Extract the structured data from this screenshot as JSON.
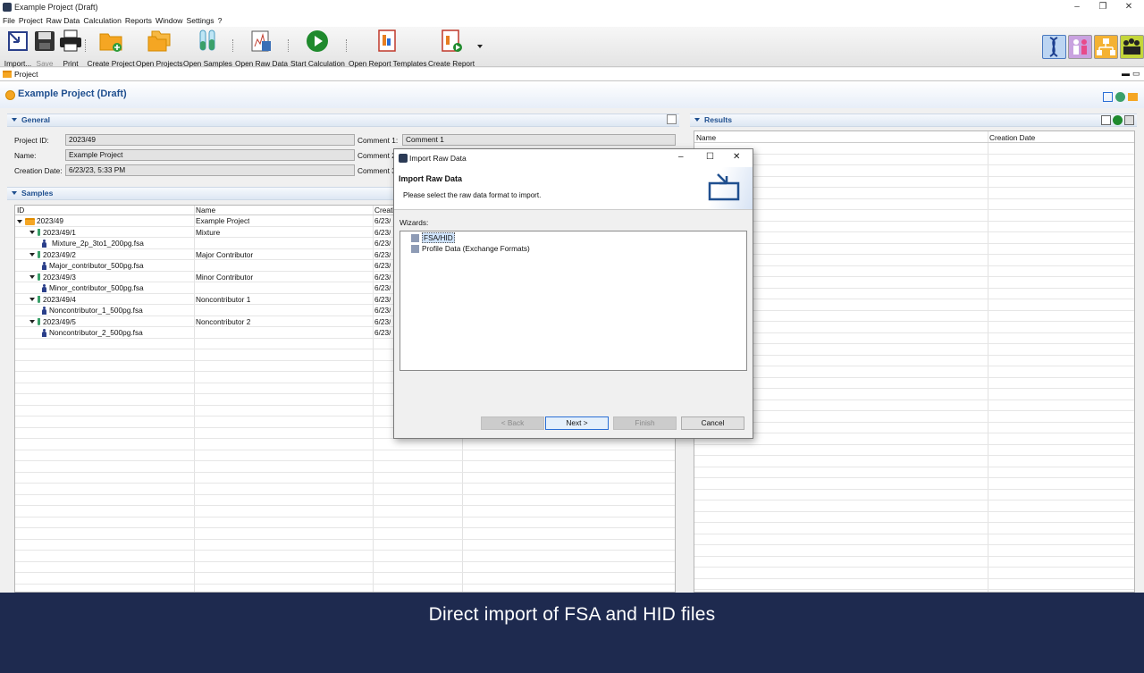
{
  "window": {
    "title": "Example Project (Draft)"
  },
  "menu": [
    "File",
    "Project",
    "Raw Data",
    "Calculation",
    "Reports",
    "Window",
    "Settings",
    "?"
  ],
  "toolbar": {
    "import": "Import...",
    "save": "Save",
    "print": "Print",
    "create_project": "Create Project",
    "open_projects": "Open Projects",
    "open_samples": "Open Samples",
    "open_raw_data": "Open Raw Data",
    "start_calculation": "Start Calculation",
    "open_report_templates": "Open Report Templates",
    "create_report": "Create Report"
  },
  "tab": {
    "project": "Project"
  },
  "project": {
    "title": "Example Project (Draft)"
  },
  "general": {
    "heading": "General",
    "project_id_label": "Project ID:",
    "project_id": "2023/49",
    "name_label": "Name:",
    "name": "Example Project",
    "creation_date_label": "Creation Date:",
    "creation_date": "6/23/23, 5:33 PM",
    "comment1_label": "Comment 1:",
    "comment1": "Comment 1",
    "comment2_label": "Comment 2",
    "comment3_label": "Comment 3"
  },
  "samples": {
    "heading": "Samples",
    "columns": [
      "ID",
      "Name",
      "Creati"
    ],
    "rows": [
      {
        "id": "2023/49",
        "name": "Example Project",
        "date": "6/23/",
        "level": 0,
        "kind": "folder"
      },
      {
        "id": "2023/49/1",
        "name": "Mixture",
        "date": "6/23/",
        "level": 1,
        "kind": "sample"
      },
      {
        "id": "Mixture_2p_3to1_200pg.fsa",
        "name": "",
        "date": "6/23/",
        "level": 2,
        "kind": "group"
      },
      {
        "id": "2023/49/2",
        "name": "Major Contributor",
        "date": "6/23/",
        "level": 1,
        "kind": "sample"
      },
      {
        "id": "Major_contributor_500pg.fsa",
        "name": "",
        "date": "6/23/",
        "level": 2,
        "kind": "person"
      },
      {
        "id": "2023/49/3",
        "name": "Minor Contributor",
        "date": "6/23/",
        "level": 1,
        "kind": "sample"
      },
      {
        "id": "Minor_contributor_500pg.fsa",
        "name": "",
        "date": "6/23/",
        "level": 2,
        "kind": "person"
      },
      {
        "id": "2023/49/4",
        "name": "Noncontributor 1",
        "date": "6/23/",
        "level": 1,
        "kind": "sample"
      },
      {
        "id": "Noncontributor_1_500pg.fsa",
        "name": "",
        "date": "6/23/",
        "level": 2,
        "kind": "person"
      },
      {
        "id": "2023/49/5",
        "name": "Noncontributor 2",
        "date": "6/23/",
        "level": 1,
        "kind": "sample"
      },
      {
        "id": "Noncontributor_2_500pg.fsa",
        "name": "",
        "date": "6/23/",
        "level": 2,
        "kind": "person"
      }
    ]
  },
  "results": {
    "heading": "Results",
    "columns": [
      "Name",
      "Creation Date"
    ]
  },
  "dialog": {
    "title": "Import Raw Data",
    "heading": "Import Raw Data",
    "subtitle": "Please select the raw data format to import.",
    "wizards_label": "Wizards:",
    "items": [
      "FSA/HID",
      "Profile Data (Exchange Formats)"
    ],
    "buttons": {
      "back": "< Back",
      "next": "Next >",
      "finish": "Finish",
      "cancel": "Cancel"
    }
  },
  "banner": {
    "text": "Direct import of FSA and HID files"
  },
  "colors": {
    "banner": "#1e2a4f",
    "section_text": "#1f4f8f",
    "accent": "#2a6fd6"
  }
}
